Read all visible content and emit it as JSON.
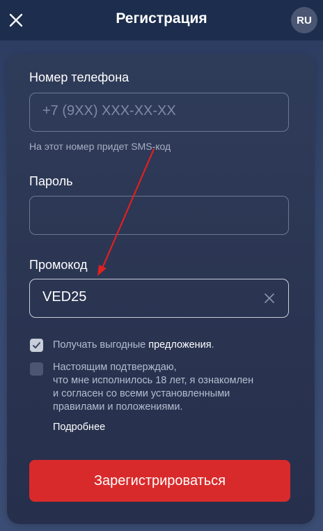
{
  "header": {
    "title": "Регистрация",
    "language": "RU"
  },
  "form": {
    "phone": {
      "label": "Номер телефона",
      "placeholder": "+7 (9XX) XXX-XX-XX",
      "hint": "На этот номер придет SMS-код"
    },
    "password": {
      "label": "Пароль",
      "value": ""
    },
    "promo": {
      "label": "Промокод",
      "value": "VED25"
    },
    "offers": {
      "checked": true,
      "text_prefix": "Получать выгодные ",
      "text_link": "предложения",
      "text_suffix": "."
    },
    "agreement": {
      "checked": false,
      "lines": [
        "Настоящим подтверждаю,",
        "что мне исполнилось 18 лет, я ознакомлен",
        "и согласен со всеми установленными",
        "правилами и положениями."
      ],
      "more_link": "Подробнее"
    },
    "submit_label": "Зарегистрироваться"
  },
  "colors": {
    "header_bg": "#1c2d4d",
    "card_bg": "#2d3855",
    "accent_red": "#d92a2b",
    "annotation_arrow": "#e02020"
  },
  "icons": {
    "close": "close-icon",
    "clear": "clear-icon",
    "check": "checkmark-icon"
  }
}
